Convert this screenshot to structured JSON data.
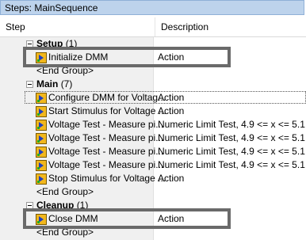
{
  "window": {
    "title": "Steps: MainSequence"
  },
  "columns": {
    "step": "Step",
    "description": "Description"
  },
  "rows": [
    {
      "kind": "group",
      "label": "Setup",
      "count": "(1)"
    },
    {
      "kind": "step",
      "label": "Initialize DMM",
      "description": "Action"
    },
    {
      "kind": "end",
      "label": "<End Group>"
    },
    {
      "kind": "group",
      "label": "Main",
      "count": "(7)"
    },
    {
      "kind": "step",
      "label": "Configure DMM for Voltag...",
      "description": "Action"
    },
    {
      "kind": "step",
      "label": "Start Stimulus for Voltage ...",
      "description": "Action"
    },
    {
      "kind": "step",
      "label": "Voltage Test - Measure pi...",
      "description": "Numeric Limit Test,  4.9 <= x <= 5.1"
    },
    {
      "kind": "step",
      "label": "Voltage Test - Measure pi...",
      "description": "Numeric Limit Test,  4.9 <= x <= 5.1"
    },
    {
      "kind": "step",
      "label": "Voltage Test - Measure pi...",
      "description": "Numeric Limit Test,  4.9 <= x <= 5.1"
    },
    {
      "kind": "step",
      "label": "Voltage Test - Measure pi...",
      "description": "Numeric Limit Test,  4.9 <= x <= 5.1"
    },
    {
      "kind": "step",
      "label": "Stop Stimulus for Voltage ...",
      "description": "Action"
    },
    {
      "kind": "end",
      "label": "<End Group>"
    },
    {
      "kind": "group",
      "label": "Cleanup",
      "count": "(1)"
    },
    {
      "kind": "step",
      "label": "Close DMM",
      "description": "Action"
    },
    {
      "kind": "end",
      "label": "<End Group>"
    }
  ],
  "colors": {
    "title_bar": "#bdd3ec",
    "step_column_shade": "#f0f0f0",
    "highlight_box": "#6a6a6a",
    "step_icon": "#f2b71c"
  },
  "icons": {
    "group_toggle": "collapse-minus-icon",
    "step": "teststand-step-icon"
  }
}
